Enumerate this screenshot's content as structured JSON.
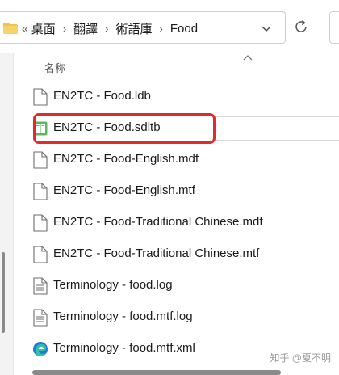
{
  "address_bar": {
    "overflow_glyph": "«",
    "crumbs": [
      "桌面",
      "翻譯",
      "術語庫",
      "Food"
    ],
    "separator": "›"
  },
  "list_header": {
    "name_label": "名称"
  },
  "files": [
    {
      "name": "EN2TC - Food.ldb",
      "icon": "document-icon"
    },
    {
      "name": "EN2TC - Food.sdltb",
      "icon": "termbase-icon",
      "highlighted": true
    },
    {
      "name": "EN2TC - Food-English.mdf",
      "icon": "document-icon"
    },
    {
      "name": "EN2TC - Food-English.mtf",
      "icon": "document-icon"
    },
    {
      "name": "EN2TC - Food-Traditional Chinese.mdf",
      "icon": "document-icon"
    },
    {
      "name": "EN2TC - Food-Traditional Chinese.mtf",
      "icon": "document-icon"
    },
    {
      "name": "Terminology - food.log",
      "icon": "text-document-icon"
    },
    {
      "name": "Terminology - food.mtf.log",
      "icon": "text-document-icon"
    },
    {
      "name": "Terminology - food.mtf.xml",
      "icon": "edge-icon"
    }
  ],
  "watermark": "知乎 @夏不明",
  "colors": {
    "highlight_border": "#e02b2b",
    "folder": "#f2c14e",
    "termbase_green": "#5cb85c",
    "edge_blue": "#1f7ae0"
  }
}
